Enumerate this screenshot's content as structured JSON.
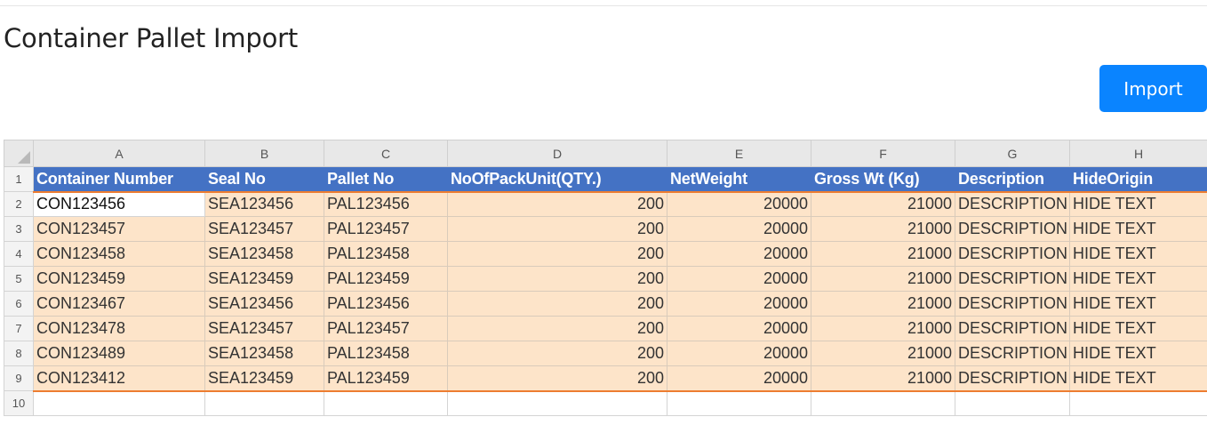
{
  "page": {
    "title": "Container Pallet Import"
  },
  "toolbar": {
    "import_label": "Import",
    "import_color": "#0a84ff"
  },
  "sheet": {
    "columns": [
      "A",
      "B",
      "C",
      "D",
      "E",
      "F",
      "G",
      "H"
    ],
    "header_row": {
      "row_number": "1",
      "labels": [
        "Container Number",
        "Seal No",
        "Pallet No",
        "NoOfPackUnit(QTY.)",
        "NetWeight",
        "Gross Wt (Kg)",
        "Description",
        "HideOrigin"
      ]
    },
    "rows": [
      {
        "n": "2",
        "c": [
          "CON123456",
          "SEA123456",
          "PAL123456",
          "200",
          "20000",
          "21000",
          "DESCRIPTION",
          "HIDE TEXT"
        ]
      },
      {
        "n": "3",
        "c": [
          "CON123457",
          "SEA123457",
          "PAL123457",
          "200",
          "20000",
          "21000",
          "DESCRIPTION",
          "HIDE TEXT"
        ]
      },
      {
        "n": "4",
        "c": [
          "CON123458",
          "SEA123458",
          "PAL123458",
          "200",
          "20000",
          "21000",
          "DESCRIPTION",
          "HIDE TEXT"
        ]
      },
      {
        "n": "5",
        "c": [
          "CON123459",
          "SEA123459",
          "PAL123459",
          "200",
          "20000",
          "21000",
          "DESCRIPTION",
          "HIDE TEXT"
        ]
      },
      {
        "n": "6",
        "c": [
          "CON123467",
          "SEA123456",
          "PAL123456",
          "200",
          "20000",
          "21000",
          "DESCRIPTION",
          "HIDE TEXT"
        ]
      },
      {
        "n": "7",
        "c": [
          "CON123478",
          "SEA123457",
          "PAL123457",
          "200",
          "20000",
          "21000",
          "DESCRIPTION",
          "HIDE TEXT"
        ]
      },
      {
        "n": "8",
        "c": [
          "CON123489",
          "SEA123458",
          "PAL123458",
          "200",
          "20000",
          "21000",
          "DESCRIPTION",
          "HIDE TEXT"
        ]
      },
      {
        "n": "9",
        "c": [
          "CON123412",
          "SEA123459",
          "PAL123459",
          "200",
          "20000",
          "21000",
          "DESCRIPTION",
          "HIDE TEXT"
        ]
      }
    ],
    "empty_row": {
      "n": "10"
    },
    "colors": {
      "header_fill": "#4472c4",
      "row_fill": "#fde4c9",
      "accent_line": "#ed7d31"
    }
  }
}
